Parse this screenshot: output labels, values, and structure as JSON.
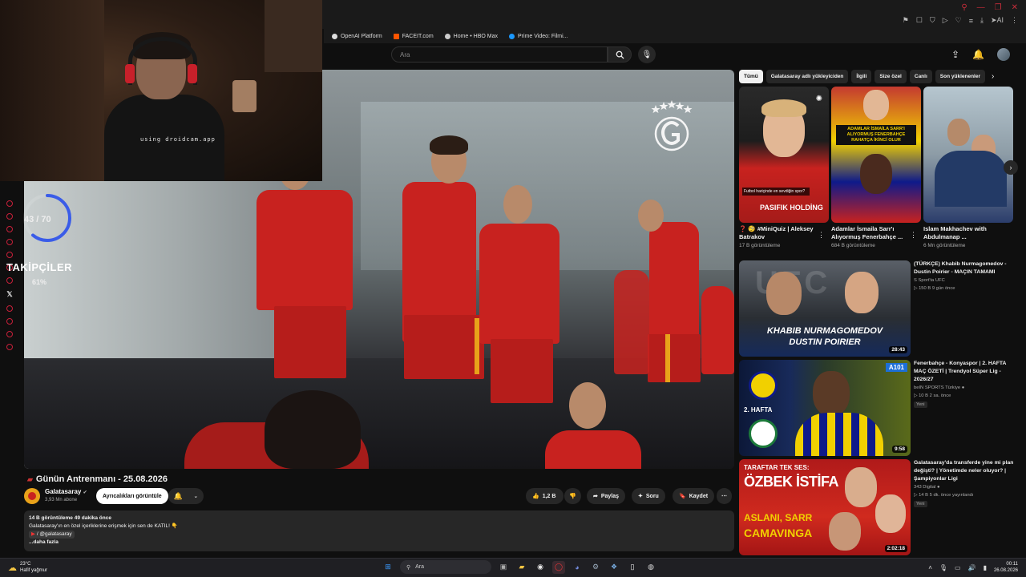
{
  "browser": {
    "bookmarks": [
      {
        "label": "OpenAI Platform",
        "color": "#dddddd"
      },
      {
        "label": "FACEIT.com",
        "color": "#ff5500"
      },
      {
        "label": "Home • HBO Max",
        "color": "#cccccc"
      },
      {
        "label": "Prime Video: Filmi...",
        "color": "#1a98ff"
      }
    ],
    "ai_label": "AI"
  },
  "youtube": {
    "search_placeholder": "Ara"
  },
  "stream_overlay": {
    "cam_text": "using droidcam.app",
    "goal_count": "43 / 70",
    "goal_progress": 0.61,
    "followers_label": "TAKİPÇİLER",
    "followers_pct": "61%"
  },
  "video": {
    "title": "Günün Antrenmanı - 25.08.2026",
    "channel": "Galatasaray",
    "verified": "✔",
    "subscribers": "3,93 Mn abone",
    "join_label": "Ayrıcalıkları görüntüle",
    "likes": "1,2 B",
    "share": "Paylaş",
    "ask": "Soru",
    "save": "Kaydet",
    "views_date": "14 B görüntüleme  49 dakika önce",
    "desc_line": "Galatasaray'ın en özel içeriklerine erişmek için sen de KATIL! 👇",
    "desc_tag": "/ @galatasaray",
    "more": "...daha fazla"
  },
  "chips": [
    "Tümü",
    "Galatasaray adlı yükleyiciden",
    "İlgili",
    "Size özel",
    "Canlı",
    "Son yüklenenler"
  ],
  "shorts": [
    {
      "title": "❓ 🧐 #MiniQuiz | Aleksey Batrakov",
      "views": "17 B görüntüleme",
      "overlay": "Futbol hariçinde en sevdiğin spor?",
      "banner": "PASIFIK HOLDİNG"
    },
    {
      "title": "Adamlar İsmaila Sarr'ı Alıyormuş Fenerbahçe ...",
      "views": "684 B görüntüleme",
      "overlay": "ADAMLAR İSMAİLA SARR'I ALIYORMUŞ FENERBAHÇE RAHATÇA İKİNCİ OLUR"
    },
    {
      "title": "Islam Makhachev with Abdulmanap ...",
      "views": "6 Mn görüntüleme"
    }
  ],
  "recommendations": [
    {
      "title": "(TÜRKÇE) Khabib Nurmagomedov - Dustin Poirier - MAÇIN TAMAMI",
      "channel": "S Sport'ta UFC",
      "meta": "▷ 150 B  9 gün önce",
      "duration": "28:43",
      "thumb_line1": "KHABIB NURMAGOMEDOV",
      "thumb_line2": "DUSTIN POIRIER",
      "thumb_logo": "UFC"
    },
    {
      "title": "Fenerbahçe - Konyaspor | 2. HAFTA MAÇ ÖZETİ | Trendyol Süper Lig - 2026/27",
      "channel": "beIN SPORTS Türkiye",
      "meta": "▷ 10 B  2 sa. önce",
      "badge": "Yeni",
      "duration": "9:58",
      "thumb_week": "2. HAFTA",
      "thumb_sponsor": "A101"
    },
    {
      "title": "Galatasaray'da transferde yine mi plan değişti? | Yönetimde neler oluyor? | Şampiyonlar Ligi",
      "channel": "343 Digital",
      "meta": "▷ 14 B  5 dk. önce yayınlandı",
      "badge": "Yeni",
      "duration": "2:02:18",
      "thumb_top": "TARAFTAR TEK SES:",
      "thumb_main": "ÖZBEK İSTİFA",
      "thumb_sub1": "ASLANI, SARR",
      "thumb_sub2": "CAMAVINGA"
    }
  ],
  "taskbar": {
    "temp": "23°C",
    "weather": "Hafif yağmur",
    "search": "Ara",
    "time": "00:11",
    "date": "26.08.2026"
  }
}
